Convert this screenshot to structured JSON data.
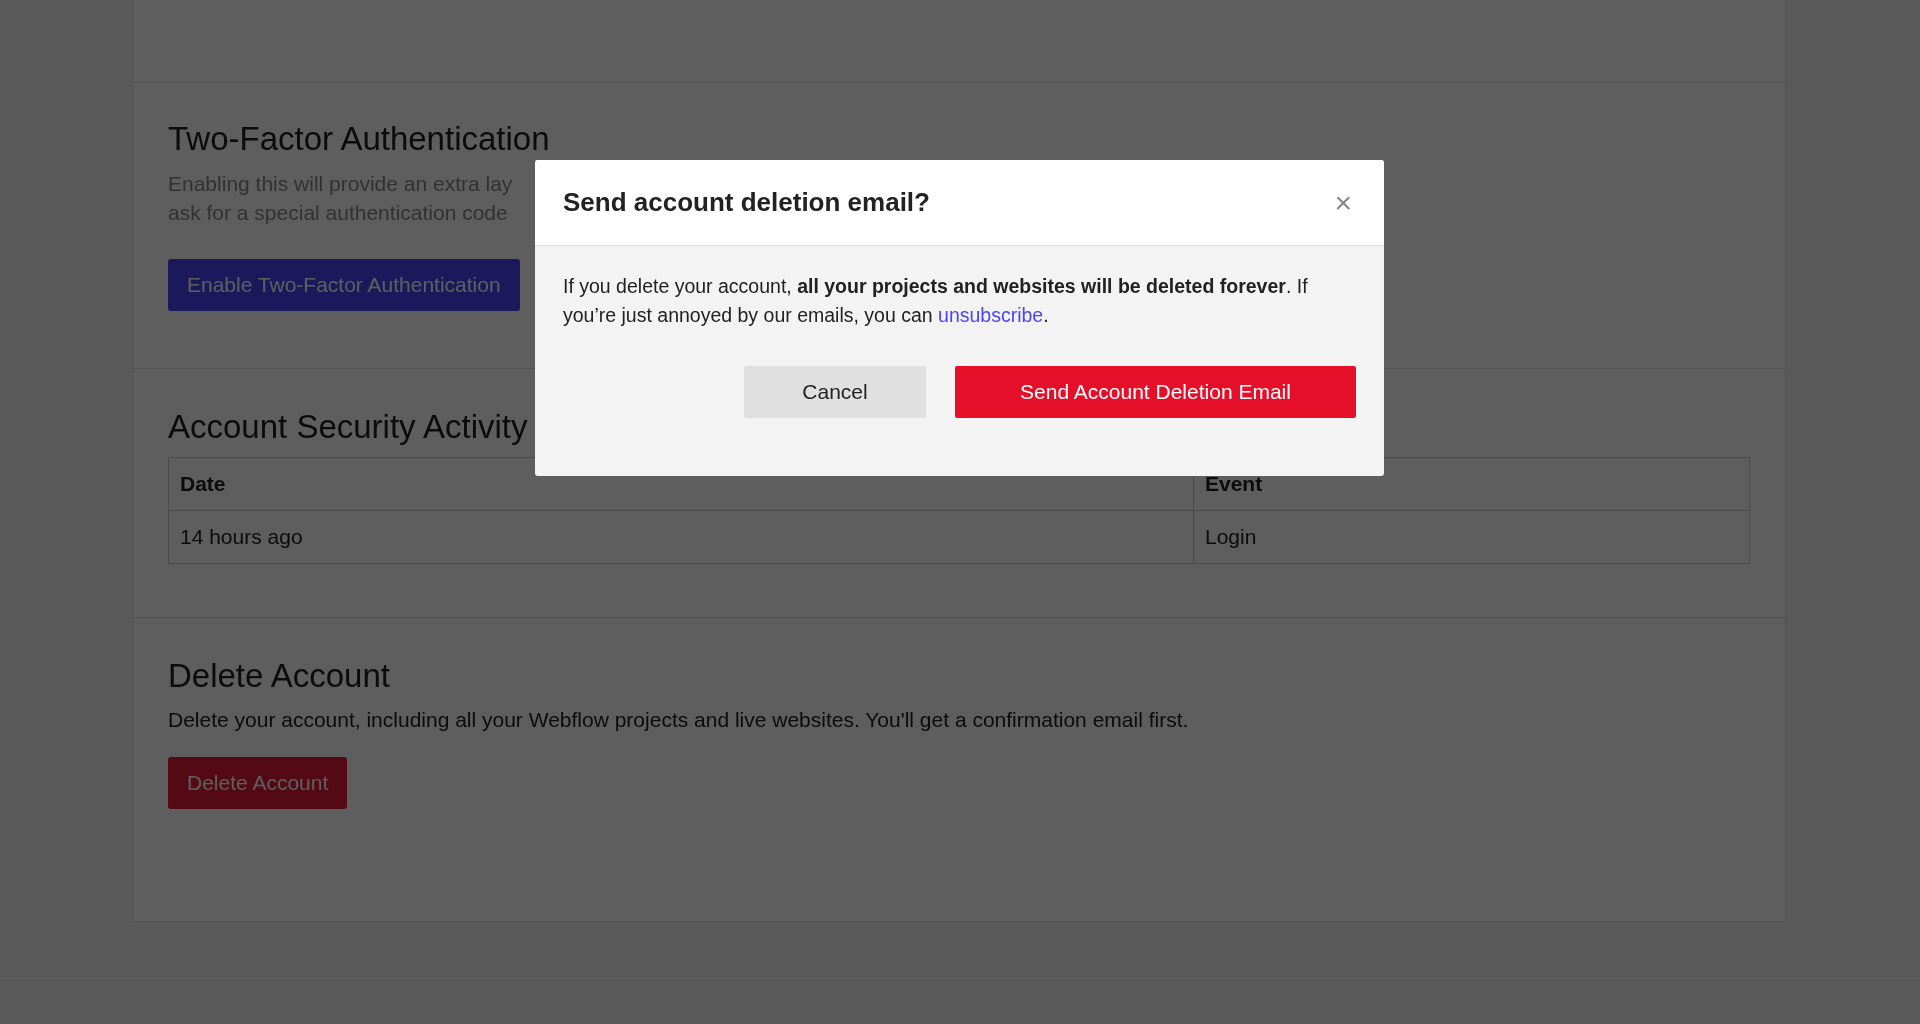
{
  "two_factor": {
    "title": "Two-Factor Authentication",
    "description_lines": [
      "Enabling this will provide an extra lay",
      "ask for a special authentication code"
    ],
    "button": "Enable Two-Factor Authentication"
  },
  "security_activity": {
    "title": "Account Security Activity",
    "columns": [
      "Date",
      "Event"
    ],
    "rows": [
      [
        "14 hours ago",
        "Login"
      ]
    ]
  },
  "delete_account": {
    "title": "Delete Account",
    "description": "Delete your account, including all your Webflow projects and live websites. You'll get a confirmation email first.",
    "button": "Delete Account"
  },
  "modal": {
    "title": "Send account deletion email?",
    "close": "×",
    "body": "If you delete your account, **all your projects and websites will be deleted forever**. If you’re just annoyed by our emails, you can ",
    "link": "unsubscribe",
    "body_end": ".",
    "cancel": "Cancel",
    "confirm": "Send Account Deletion Email"
  }
}
